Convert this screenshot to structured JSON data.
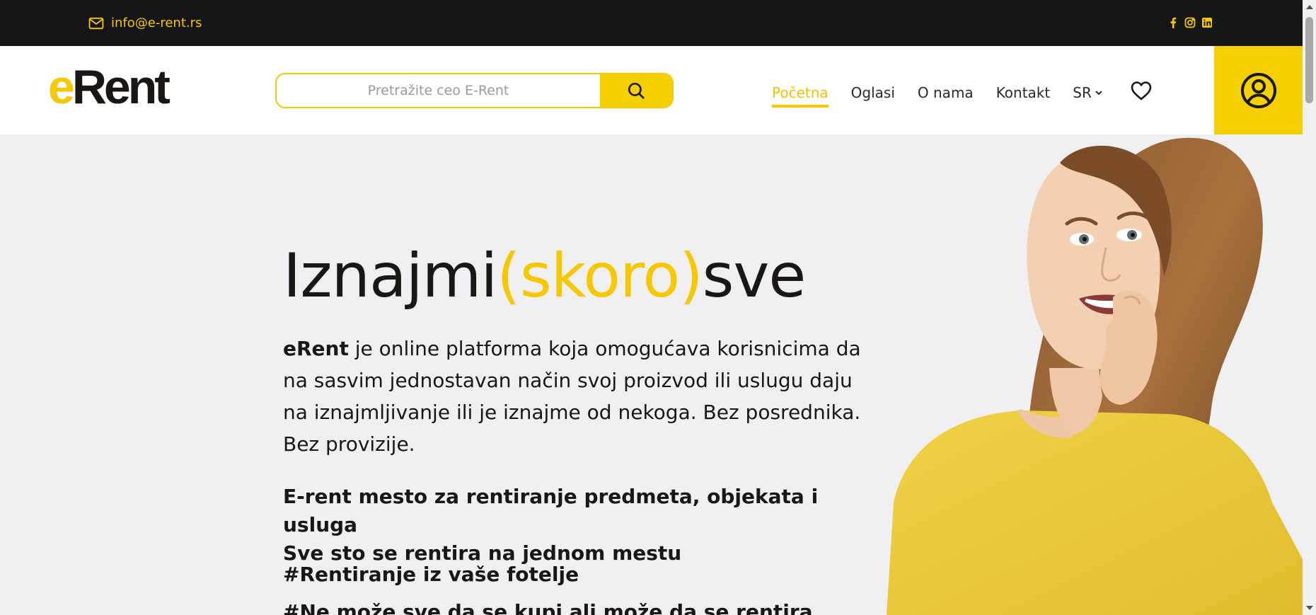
{
  "topbar": {
    "email": "info@e-rent.rs",
    "icons": [
      "mail-icon",
      "facebook-icon",
      "instagram-icon",
      "linkedin-icon"
    ]
  },
  "header": {
    "logo": {
      "e": "e",
      "rent": "Rent"
    },
    "search": {
      "placeholder": "Pretražite ceo E-Rent",
      "button_icon": "search-icon"
    },
    "nav": [
      {
        "label": "Početna",
        "active": true
      },
      {
        "label": "Oglasi",
        "active": false
      },
      {
        "label": "O nama",
        "active": false
      },
      {
        "label": "Kontakt",
        "active": false
      }
    ],
    "language": "SR",
    "favorites_icon": "heart-icon",
    "account_icon": "user-icon"
  },
  "hero": {
    "title_part1": "Iznajmi",
    "title_highlight": "(skoro)",
    "title_part2": "sve",
    "desc_brand": "eRent",
    "desc_text": " je online platforma koja omogućava korisnicima da na sasvim jednostavan način svoj proizvod ili uslugu daju na iznajmljivanje ili je iznajme od nekoga. Bez posrednika. Bez provizije.",
    "tagline_line1": "E-rent mesto za rentiranje predmeta, objekata i usluga",
    "tagline_line2": "Sve sto se rentira na jednom mestu",
    "hashtag1": "#Rentiranje iz vaše fotelje",
    "hashtag2": "#Ne može sve da se kupi ali može da se rentira"
  },
  "colors": {
    "accent": "#f5d000",
    "topbar": "#151515",
    "background": "#f0f0f3",
    "text": "#1a1614"
  }
}
